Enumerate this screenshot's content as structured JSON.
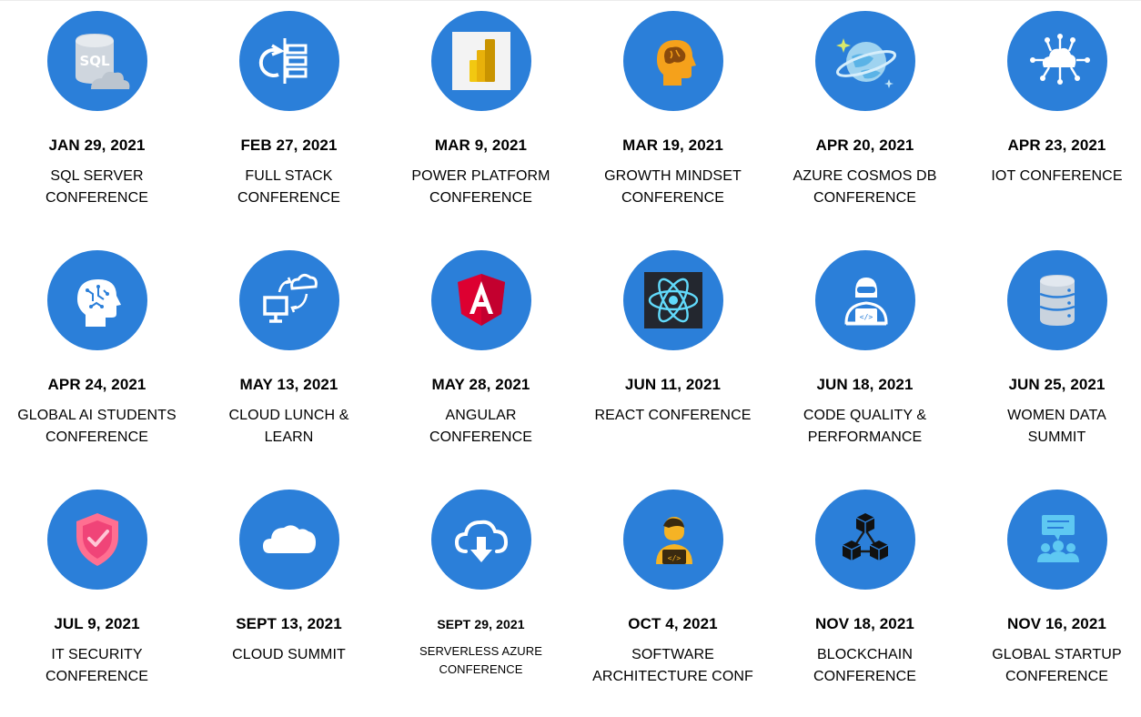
{
  "events": [
    {
      "date": "JAN 29, 2021",
      "line1": "SQL SERVER",
      "line2": "CONFERENCE",
      "icon": "sql-server-icon"
    },
    {
      "date": "FEB 27, 2021",
      "line1": "FULL STACK",
      "line2": "CONFERENCE",
      "icon": "full-stack-icon"
    },
    {
      "date": "MAR 9, 2021",
      "line1": "POWER PLATFORM",
      "line2": "CONFERENCE",
      "icon": "power-bi-icon"
    },
    {
      "date": "MAR 19, 2021",
      "line1": "GROWTH MINDSET",
      "line2": "CONFERENCE",
      "icon": "brain-head-icon"
    },
    {
      "date": "APR 20, 2021",
      "line1": "AZURE COSMOS DB",
      "line2": "CONFERENCE",
      "icon": "cosmos-db-icon"
    },
    {
      "date": "APR 23, 2021",
      "line1": "IOT CONFERENCE",
      "line2": "",
      "icon": "cloud-network-icon"
    },
    {
      "date": "APR 24, 2021",
      "line1": "GLOBAL AI STUDENTS",
      "line2": "CONFERENCE",
      "icon": "ai-head-icon"
    },
    {
      "date": "MAY 13, 2021",
      "line1": "CLOUD LUNCH &",
      "line2": "LEARN",
      "icon": "cloud-sync-icon"
    },
    {
      "date": "MAY 28, 2021",
      "line1": "ANGULAR",
      "line2": "CONFERENCE",
      "icon": "angular-icon"
    },
    {
      "date": "JUN 11, 2021",
      "line1": "REACT CONFERENCE",
      "line2": "",
      "icon": "react-icon"
    },
    {
      "date": "JUN 18, 2021",
      "line1": "CODE QUALITY &",
      "line2": "PERFORMANCE",
      "icon": "developer-icon"
    },
    {
      "date": "JUN 25, 2021",
      "line1": "WOMEN DATA",
      "line2": "SUMMIT",
      "icon": "database-icon"
    },
    {
      "date": "JUL 9, 2021",
      "line1": "IT SECURITY",
      "line2": "CONFERENCE",
      "icon": "shield-check-icon"
    },
    {
      "date": "SEPT 13, 2021",
      "line1": "CLOUD SUMMIT",
      "line2": "",
      "icon": "cloud-icon"
    },
    {
      "date": "SEPT 29, 2021",
      "line1": "SERVERLESS AZURE",
      "line2": "CONFERENCE",
      "icon": "cloud-download-icon"
    },
    {
      "date": "OCT 4, 2021",
      "line1": "SOFTWARE",
      "line2": "ARCHITECTURE CONF",
      "icon": "software-architect-icon"
    },
    {
      "date": "NOV 18, 2021",
      "line1": "BLOCKCHAIN",
      "line2": "CONFERENCE",
      "icon": "blockchain-icon"
    },
    {
      "date": "NOV 16, 2021",
      "line1": "GLOBAL STARTUP",
      "line2": "CONFERENCE",
      "icon": "presentation-icon"
    }
  ],
  "colors": {
    "circle": "#2b7fd9",
    "text": "#000000",
    "background": "#ffffff"
  }
}
